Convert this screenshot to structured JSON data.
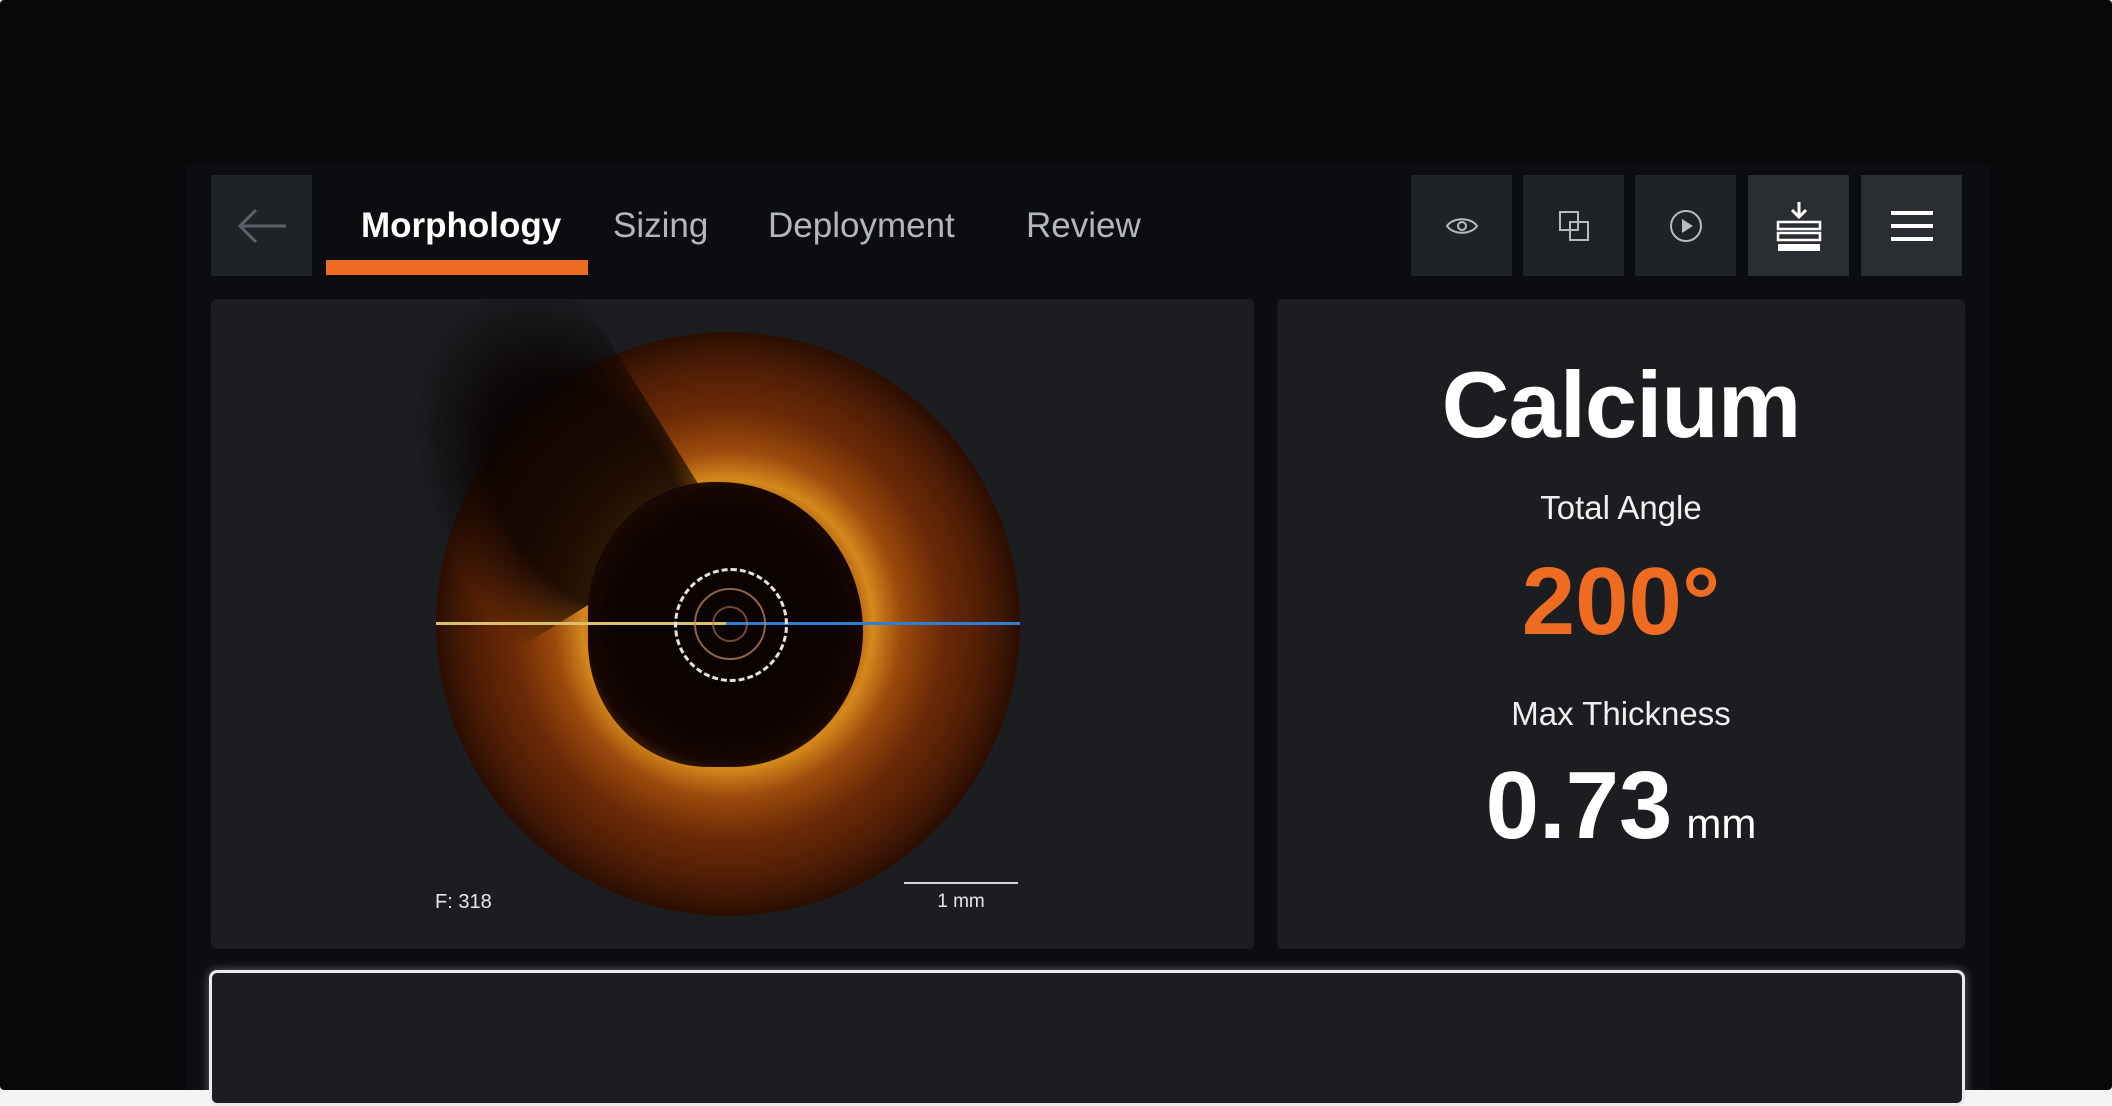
{
  "tabs": [
    {
      "label": "Morphology",
      "active": true
    },
    {
      "label": "Sizing",
      "active": false
    },
    {
      "label": "Deployment",
      "active": false
    },
    {
      "label": "Review",
      "active": false
    }
  ],
  "toolbar": {
    "icons": [
      "eye-icon",
      "copy-icon",
      "play-icon",
      "download-layers-icon",
      "menu-icon"
    ]
  },
  "image": {
    "frame_label": "F: 318",
    "scale_label": "1 mm"
  },
  "result": {
    "title": "Calcium",
    "angle_label": "Total Angle",
    "angle_value": "200°",
    "thickness_label": "Max Thickness",
    "thickness_value": "0.73",
    "thickness_unit": "mm"
  },
  "colors": {
    "accent": "#ee6b22",
    "background": "#0b0d10",
    "panel": "#1b1d21"
  }
}
